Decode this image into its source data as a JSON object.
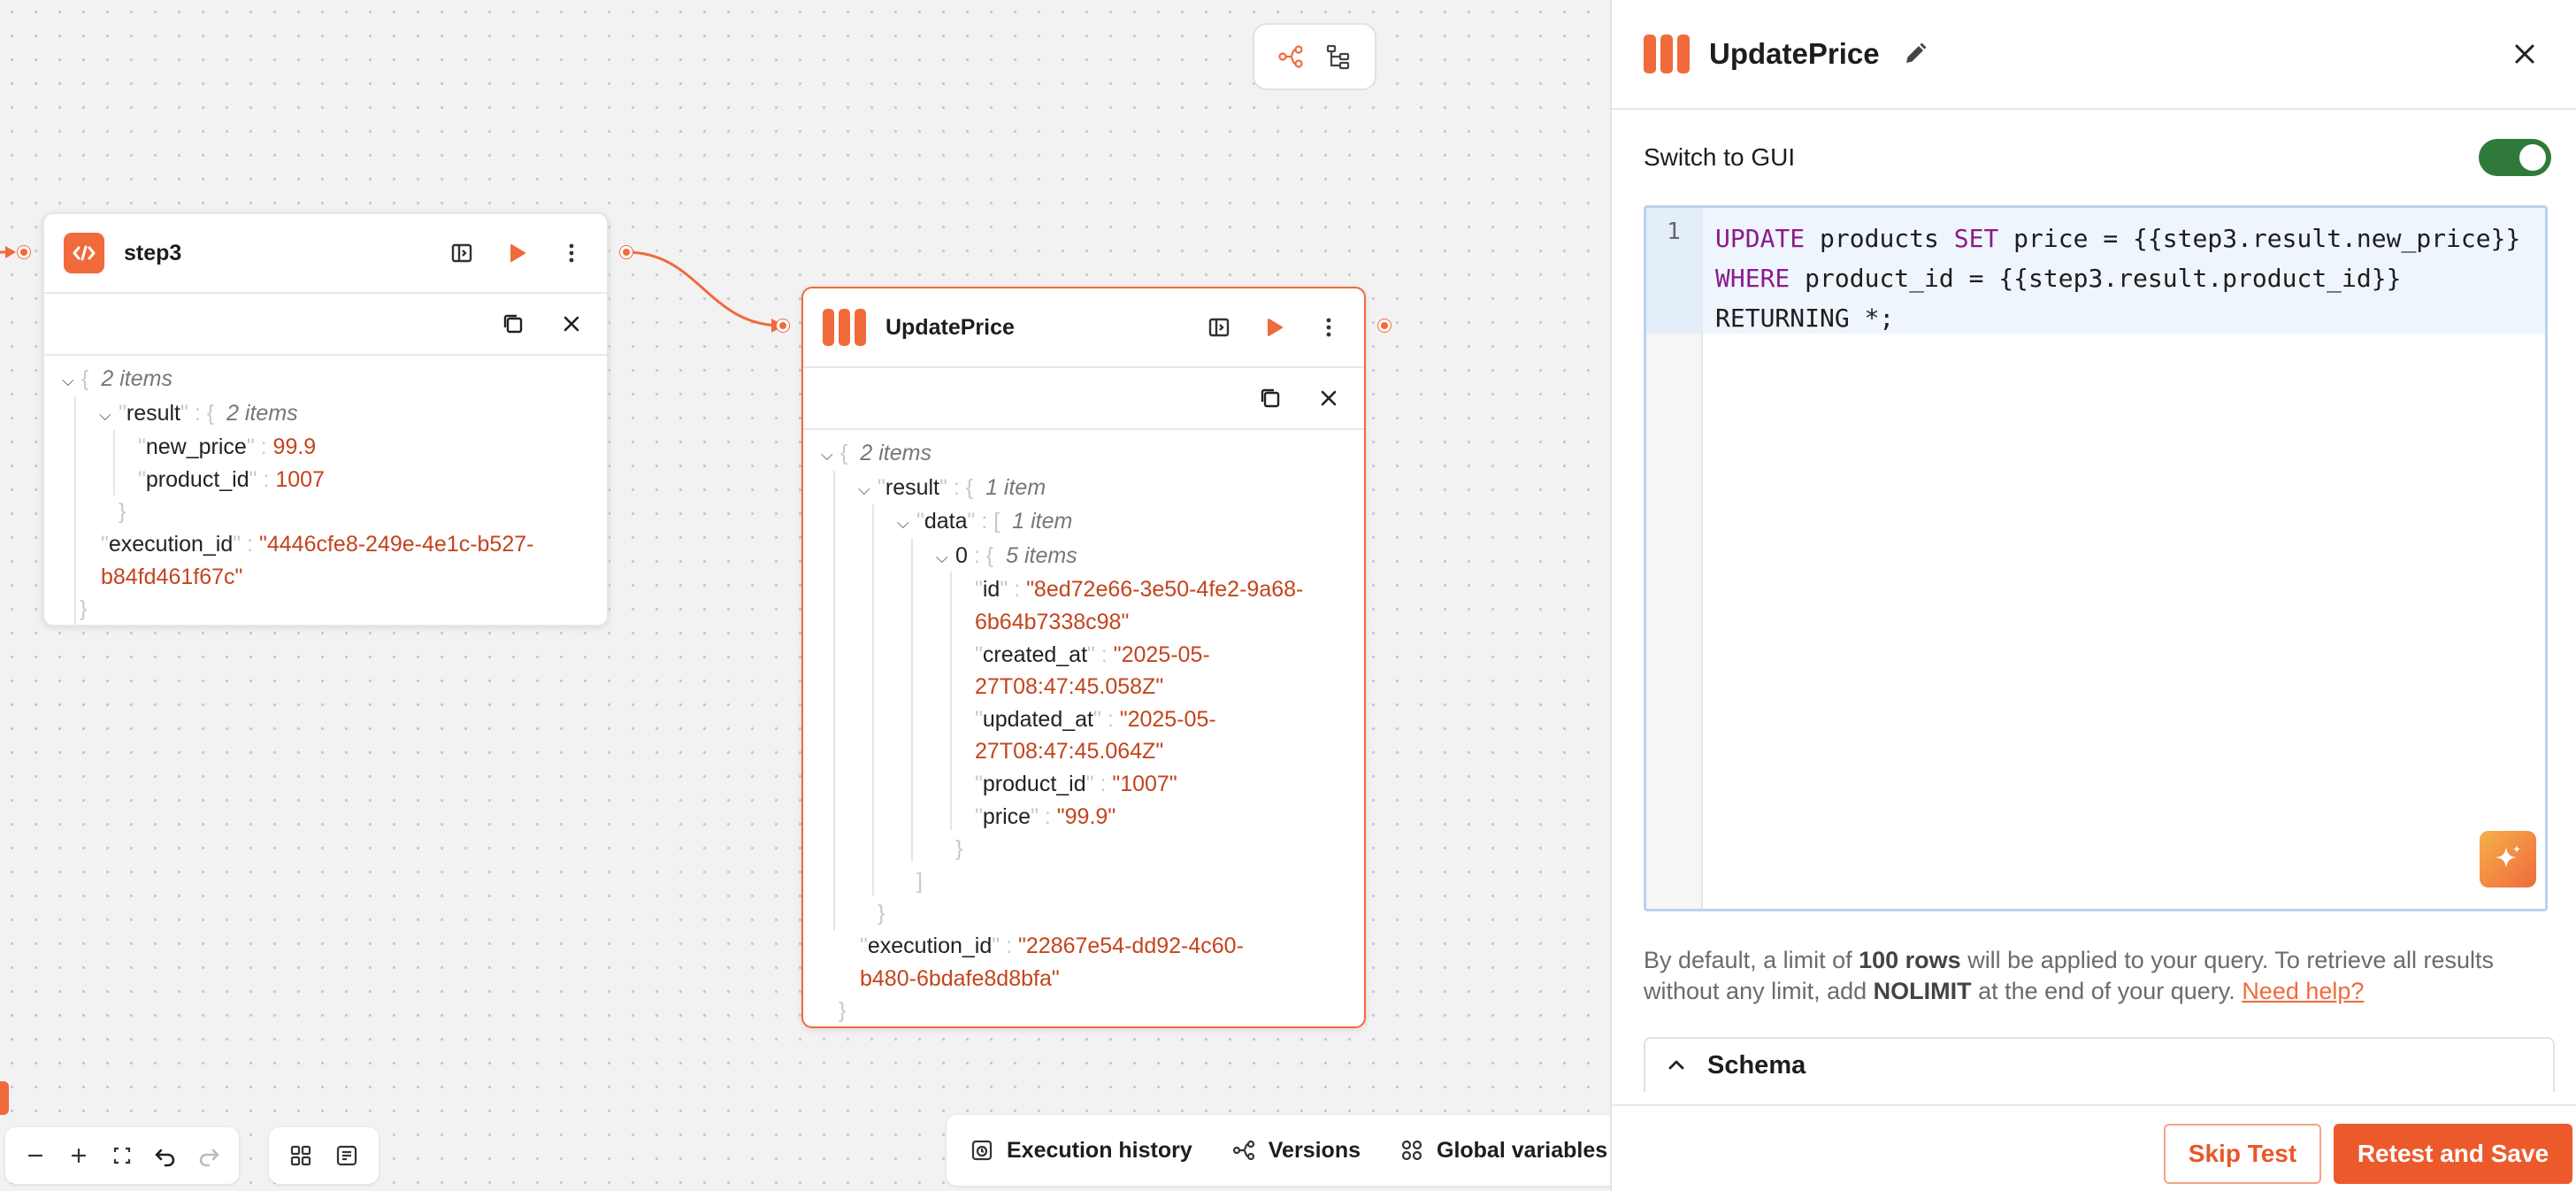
{
  "canvas": {
    "view_toggle": {
      "icons": [
        "workflow-graph-icon",
        "tree-view-icon"
      ]
    },
    "nodes": {
      "step3": {
        "title": "step3",
        "icon": "code-icon",
        "output": {
          "root_count": "2 items",
          "result_key": "result",
          "result_count": "2 items",
          "new_price_key": "new_price",
          "new_price_value": "99.9",
          "product_id_key": "product_id",
          "product_id_value": "1007",
          "execution_id_key": "execution_id",
          "execution_id_line1": "\"4446cfe8-249e-4e1c-b527-",
          "execution_id_line2": "b84fd461f67c\""
        }
      },
      "update_price": {
        "title": "UpdatePrice",
        "icon": "postgres-bars-icon",
        "output": {
          "root_count": "2 items",
          "result_key": "result",
          "result_count": "1 item",
          "data_key": "data",
          "data_count": "1 item",
          "index_key": "0",
          "index_count": "5 items",
          "id_key": "id",
          "id_line1": "\"8ed72e66-3e50-4fe2-9a68-",
          "id_line2": "6b64b7338c98\"",
          "created_at_key": "created_at",
          "created_at_line1": "\"2025-05-",
          "created_at_line2": "27T08:47:45.058Z\"",
          "updated_at_key": "updated_at",
          "updated_at_line1": "\"2025-05-",
          "updated_at_line2": "27T08:47:45.064Z\"",
          "product_id_key": "product_id",
          "product_id_value": "\"1007\"",
          "price_key": "price",
          "price_value": "\"99.9\"",
          "execution_id_key": "execution_id",
          "execution_id_line1": "\"22867e54-dd92-4c60-",
          "execution_id_line2": "b480-6bdafe8d8bfa\""
        }
      }
    },
    "bottom_bar": {
      "execution_history": "Execution history",
      "versions": "Versions",
      "global_variables": "Global variables"
    }
  },
  "panel": {
    "title": "UpdatePrice",
    "switch_label": "Switch to GUI",
    "switch_on": true,
    "editor": {
      "line_number": "1",
      "code_lines": [
        "UPDATE products SET price = {{step3.result.new_price}}",
        "WHERE product_id = {{step3.result.product_id}}",
        "RETURNING *;"
      ]
    },
    "help": {
      "part1": "By default, a limit of ",
      "bold1": "100 rows",
      "part2": " will be applied to your query. To retrieve all results without any limit, add ",
      "bold2": "NOLIMIT",
      "part3": " at the end of your query. ",
      "link": "Need help?"
    },
    "schema_label": "Schema",
    "skip_button": "Skip Test",
    "retest_button": "Retest and Save"
  },
  "colors": {
    "accent": "#f06a3c",
    "toggle_on": "#2f7a3a",
    "json_value": "#c4441c",
    "sql_keyword": "#8b1a8b"
  }
}
